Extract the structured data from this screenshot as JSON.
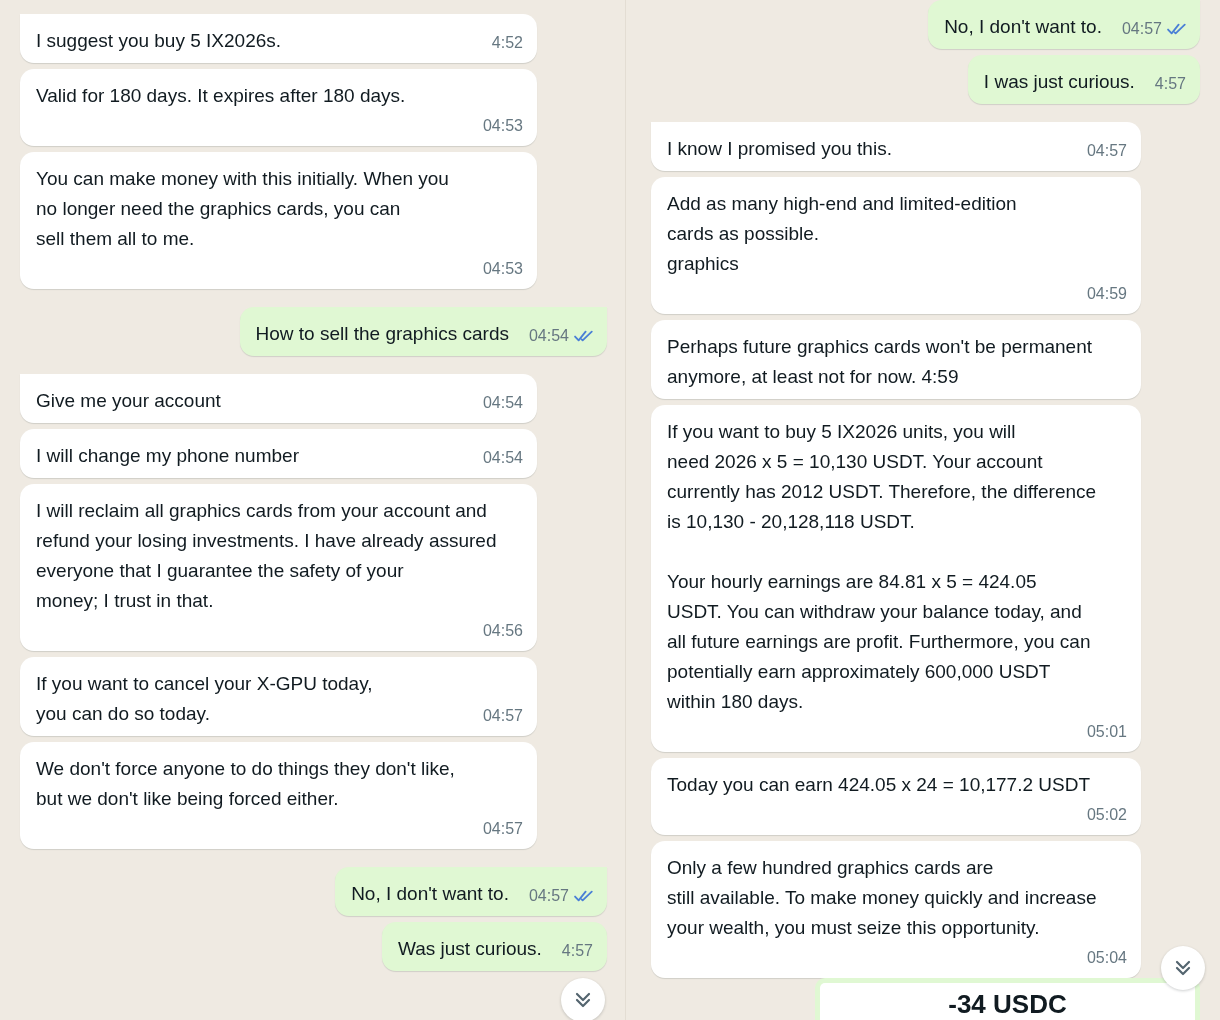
{
  "panels": [
    {
      "messages": [
        {
          "kind": "text",
          "outgoing": false,
          "paragraphs": [
            [
              "I suggest you buy 5 IX2026s."
            ]
          ],
          "time": "4:52"
        },
        {
          "kind": "text",
          "outgoing": false,
          "paragraphs": [
            [
              "Valid for 180 days. It expires after 180 days."
            ]
          ],
          "time": "04:53"
        },
        {
          "kind": "text",
          "outgoing": false,
          "paragraphs": [
            [
              "You can make money with this initially. When you",
              "no longer need the graphics cards, you can",
              "sell them all to me."
            ]
          ],
          "time": "04:53"
        },
        {
          "kind": "text",
          "outgoing": true,
          "paragraphs": [
            [
              "How to sell the graphics cards"
            ]
          ],
          "time": "04:54",
          "read": true
        },
        {
          "kind": "text",
          "outgoing": false,
          "paragraphs": [
            [
              "Give me your account"
            ]
          ],
          "time": "04:54"
        },
        {
          "kind": "text",
          "outgoing": false,
          "paragraphs": [
            [
              "I will change my phone number"
            ]
          ],
          "time": "04:54"
        },
        {
          "kind": "text",
          "outgoing": false,
          "paragraphs": [
            [
              "I will reclaim all graphics cards from your account and",
              "refund your losing investments. I have already assured",
              "everyone that I guarantee the safety of your",
              "money; I trust in that."
            ]
          ],
          "time": "04:56"
        },
        {
          "kind": "text",
          "outgoing": false,
          "paragraphs": [
            [
              "If you want to cancel your X-GPU today,",
              "you can do so today."
            ]
          ],
          "time": "04:57"
        },
        {
          "kind": "text",
          "outgoing": false,
          "paragraphs": [
            [
              "We don't force anyone to do things they don't like,",
              "but we don't like being forced either."
            ]
          ],
          "time": "04:57"
        },
        {
          "kind": "text",
          "outgoing": true,
          "paragraphs": [
            [
              "No, I don't want to."
            ]
          ],
          "time": "04:57",
          "read": true
        },
        {
          "kind": "text",
          "outgoing": true,
          "paragraphs": [
            [
              "Was just curious."
            ]
          ],
          "time": "4:57"
        }
      ],
      "scroll_button": true
    },
    {
      "messages": [
        {
          "kind": "text",
          "outgoing": true,
          "paragraphs": [
            [
              "No, I don't want to."
            ]
          ],
          "time": "04:57",
          "read": true
        },
        {
          "kind": "text",
          "outgoing": true,
          "paragraphs": [
            [
              "I was just curious."
            ]
          ],
          "time": "4:57"
        },
        {
          "kind": "text",
          "outgoing": false,
          "paragraphs": [
            [
              "I know I promised you this."
            ]
          ],
          "time": "04:57"
        },
        {
          "kind": "text",
          "outgoing": false,
          "paragraphs": [
            [
              "Add as many high-end and limited-edition",
              "cards as possible.",
              "graphics"
            ]
          ],
          "time": "04:59"
        },
        {
          "kind": "text",
          "outgoing": false,
          "paragraphs": [
            [
              "Perhaps future graphics cards won't be permanent",
              "anymore, at least not for now. 4:59"
            ]
          ]
        },
        {
          "kind": "text",
          "outgoing": false,
          "paragraphs": [
            [
              "If you want to buy 5 IX2026 units, you will",
              "need 2026 x 5 = 10,130 USDT. Your account",
              "currently has 2012 USDT. Therefore, the difference",
              "is 10,130 - 20,128,118 USDT."
            ],
            [
              "Your hourly earnings are 84.81 x 5 = 424.05",
              "USDT. You can withdraw your balance today, and",
              "all future earnings are profit. Furthermore, you can",
              "potentially earn approximately 600,000 USDT",
              "within 180 days."
            ]
          ],
          "time": "05:01"
        },
        {
          "kind": "text",
          "outgoing": false,
          "paragraphs": [
            [
              "Today you can earn 424.05 x 24 = 10,177.2 USDT"
            ]
          ],
          "time": "05:02"
        },
        {
          "kind": "text",
          "outgoing": false,
          "paragraphs": [
            [
              "Only a few hundred graphics cards are",
              "still available. To make money quickly and increase",
              "your wealth, you must seize this opportunity."
            ]
          ],
          "time": "05:04"
        },
        {
          "kind": "payment",
          "outgoing": true,
          "amount": "-34 USDC"
        }
      ],
      "scroll_button": true
    }
  ]
}
